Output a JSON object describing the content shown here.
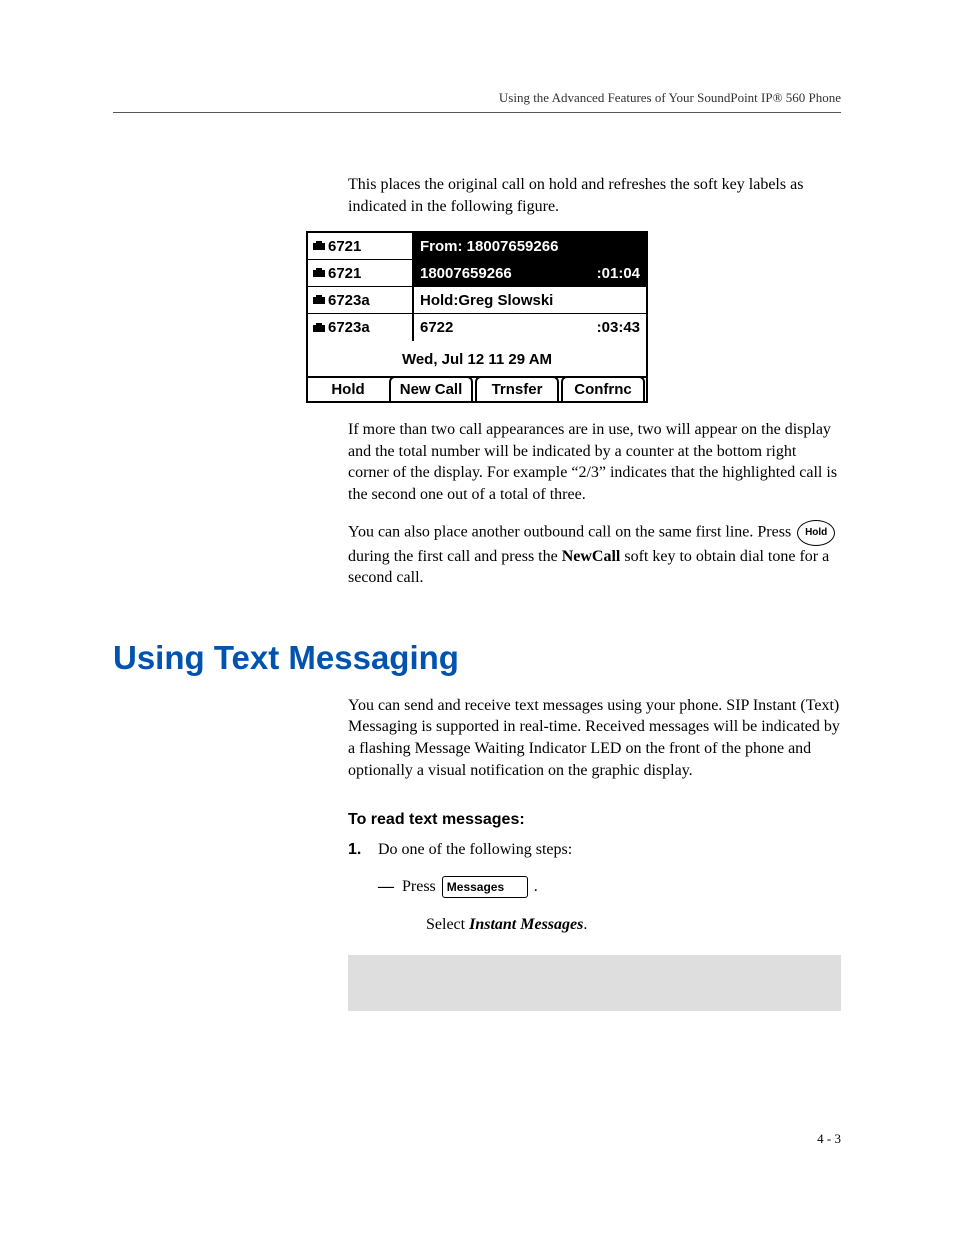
{
  "header": {
    "running": "Using the Advanced Features of Your SoundPoint IP® 560 Phone"
  },
  "intro": {
    "p1": "This places the original call on hold and refreshes the soft key labels as indicated in the following figure."
  },
  "phone_screen": {
    "lines": [
      {
        "ext": "6721",
        "right_label": "From: 18007659266",
        "right_time": "",
        "highlighted": true
      },
      {
        "ext": "6721",
        "right_label": "18007659266",
        "right_time": ":01:04",
        "highlighted": true
      },
      {
        "ext": "6723a",
        "right_label": "Hold:Greg Slowski",
        "right_time": "",
        "highlighted": false
      },
      {
        "ext": "6723a",
        "right_label": "6722",
        "right_time": ":03:43",
        "highlighted": false
      }
    ],
    "datetime": "Wed, Jul 12  11 29 AM",
    "softkeys": [
      "Hold",
      "New Call",
      "Trnsfer",
      "Confrnc"
    ]
  },
  "after_fig": {
    "p2": "If more than two call appearances are in use, two will appear on the display and the total number will be indicated by a counter at the bottom right corner of the display. For example “2/3” indicates that the highlighted call is the second one out of a total of three.",
    "p3a": "You can also place another outbound call on the same first line. Press ",
    "hold_btn": "Hold",
    "p3b": "during the first call and press the ",
    "p3b_bold": "NewCall",
    "p3c": " soft key to obtain dial tone for a second call."
  },
  "section": {
    "title": "Using Text Messaging",
    "p4": "You can send and receive text messages using your phone. SIP Instant (Text) Messaging is supported in real-time. Received messages will be indicated by a flashing Message Waiting Indicator LED on the front of the phone and optionally a visual notification on the graphic display."
  },
  "procedure": {
    "title": "To read text messages:",
    "step1": "Do one of the following steps:",
    "sub_press": "Press ",
    "messages_btn": "Messages",
    "sub_period": " .",
    "sub_select_a": "Select ",
    "sub_select_i": "Instant Messages",
    "sub_select_b": "."
  },
  "footer": {
    "page": "4 - 3"
  }
}
